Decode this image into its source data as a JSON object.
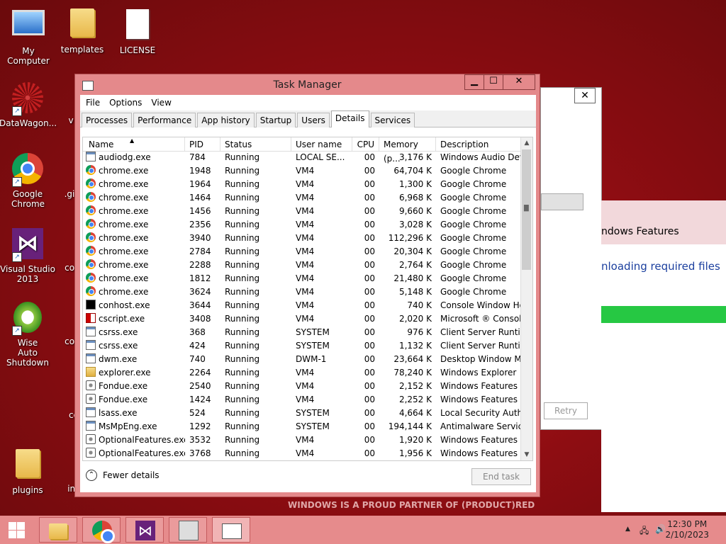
{
  "desktop": {
    "icons": [
      {
        "label": "My Computer"
      },
      {
        "label": "templates"
      },
      {
        "label": "LICENSE"
      },
      {
        "label": "DataWagon..."
      },
      {
        "label": "Google Chrome"
      },
      {
        "label": "Visual Studio 2013"
      },
      {
        "label": "Wise Auto Shutdown"
      },
      {
        "label": "plugins"
      }
    ],
    "partial_labels": [
      "v",
      ".gi",
      "com",
      "com",
      "co",
      "inc"
    ]
  },
  "background_window": {
    "close_glyph": "✕",
    "features_title": "ndows Features",
    "status_text": "nloading required files",
    "retry_label": "Retry"
  },
  "task_manager": {
    "title": "Task Manager",
    "menu": [
      "File",
      "Options",
      "View"
    ],
    "tabs": [
      "Processes",
      "Performance",
      "App history",
      "Startup",
      "Users",
      "Details",
      "Services"
    ],
    "active_tab": "Details",
    "columns": [
      "Name",
      "PID",
      "Status",
      "User name",
      "CPU",
      "Memory (p...",
      "Description"
    ],
    "rows": [
      {
        "icon": "window-icon",
        "name": "audiodg.exe",
        "pid": "784",
        "status": "Running",
        "user": "LOCAL SE...",
        "cpu": "00",
        "mem": "3,176 K",
        "desc": "Windows Audio Dev..."
      },
      {
        "icon": "chrome-icon",
        "name": "chrome.exe",
        "pid": "1948",
        "status": "Running",
        "user": "VM4",
        "cpu": "00",
        "mem": "64,704 K",
        "desc": "Google Chrome"
      },
      {
        "icon": "chrome-icon",
        "name": "chrome.exe",
        "pid": "1964",
        "status": "Running",
        "user": "VM4",
        "cpu": "00",
        "mem": "1,300 K",
        "desc": "Google Chrome"
      },
      {
        "icon": "chrome-icon",
        "name": "chrome.exe",
        "pid": "1464",
        "status": "Running",
        "user": "VM4",
        "cpu": "00",
        "mem": "6,968 K",
        "desc": "Google Chrome"
      },
      {
        "icon": "chrome-icon",
        "name": "chrome.exe",
        "pid": "1456",
        "status": "Running",
        "user": "VM4",
        "cpu": "00",
        "mem": "9,660 K",
        "desc": "Google Chrome"
      },
      {
        "icon": "chrome-icon",
        "name": "chrome.exe",
        "pid": "2356",
        "status": "Running",
        "user": "VM4",
        "cpu": "00",
        "mem": "3,028 K",
        "desc": "Google Chrome"
      },
      {
        "icon": "chrome-icon",
        "name": "chrome.exe",
        "pid": "3940",
        "status": "Running",
        "user": "VM4",
        "cpu": "00",
        "mem": "112,296 K",
        "desc": "Google Chrome"
      },
      {
        "icon": "chrome-icon",
        "name": "chrome.exe",
        "pid": "2784",
        "status": "Running",
        "user": "VM4",
        "cpu": "00",
        "mem": "20,304 K",
        "desc": "Google Chrome"
      },
      {
        "icon": "chrome-icon",
        "name": "chrome.exe",
        "pid": "2288",
        "status": "Running",
        "user": "VM4",
        "cpu": "00",
        "mem": "2,764 K",
        "desc": "Google Chrome"
      },
      {
        "icon": "chrome-icon",
        "name": "chrome.exe",
        "pid": "1812",
        "status": "Running",
        "user": "VM4",
        "cpu": "00",
        "mem": "21,480 K",
        "desc": "Google Chrome"
      },
      {
        "icon": "chrome-icon",
        "name": "chrome.exe",
        "pid": "3624",
        "status": "Running",
        "user": "VM4",
        "cpu": "00",
        "mem": "5,148 K",
        "desc": "Google Chrome"
      },
      {
        "icon": "console-icon",
        "name": "conhost.exe",
        "pid": "3644",
        "status": "Running",
        "user": "VM4",
        "cpu": "00",
        "mem": "740 K",
        "desc": "Console Window Host"
      },
      {
        "icon": "script-icon",
        "name": "cscript.exe",
        "pid": "3408",
        "status": "Running",
        "user": "VM4",
        "cpu": "00",
        "mem": "2,020 K",
        "desc": "Microsoft ® Consol..."
      },
      {
        "icon": "window-icon",
        "name": "csrss.exe",
        "pid": "368",
        "status": "Running",
        "user": "SYSTEM",
        "cpu": "00",
        "mem": "976 K",
        "desc": "Client Server Runtim..."
      },
      {
        "icon": "window-icon",
        "name": "csrss.exe",
        "pid": "424",
        "status": "Running",
        "user": "SYSTEM",
        "cpu": "00",
        "mem": "1,132 K",
        "desc": "Client Server Runtim..."
      },
      {
        "icon": "window-icon",
        "name": "dwm.exe",
        "pid": "740",
        "status": "Running",
        "user": "DWM-1",
        "cpu": "00",
        "mem": "23,664 K",
        "desc": "Desktop Window M..."
      },
      {
        "icon": "folder-icon",
        "name": "explorer.exe",
        "pid": "2264",
        "status": "Running",
        "user": "VM4",
        "cpu": "00",
        "mem": "78,240 K",
        "desc": "Windows Explorer"
      },
      {
        "icon": "gear-icon",
        "name": "Fondue.exe",
        "pid": "2540",
        "status": "Running",
        "user": "VM4",
        "cpu": "00",
        "mem": "2,152 K",
        "desc": "Windows Features o..."
      },
      {
        "icon": "gear-icon",
        "name": "Fondue.exe",
        "pid": "1424",
        "status": "Running",
        "user": "VM4",
        "cpu": "00",
        "mem": "2,252 K",
        "desc": "Windows Features o..."
      },
      {
        "icon": "window-icon",
        "name": "lsass.exe",
        "pid": "524",
        "status": "Running",
        "user": "SYSTEM",
        "cpu": "00",
        "mem": "4,664 K",
        "desc": "Local Security Autho..."
      },
      {
        "icon": "window-icon",
        "name": "MsMpEng.exe",
        "pid": "1292",
        "status": "Running",
        "user": "SYSTEM",
        "cpu": "00",
        "mem": "194,144 K",
        "desc": "Antimalware Service..."
      },
      {
        "icon": "gear-icon",
        "name": "OptionalFeatures.exe",
        "pid": "3532",
        "status": "Running",
        "user": "VM4",
        "cpu": "00",
        "mem": "1,920 K",
        "desc": "Windows Features"
      },
      {
        "icon": "gear-icon",
        "name": "OptionalFeatures.exe",
        "pid": "3768",
        "status": "Running",
        "user": "VM4",
        "cpu": "00",
        "mem": "1,956 K",
        "desc": "Windows Features"
      }
    ],
    "fewer_details": "Fewer details",
    "end_task": "End task"
  },
  "watermark": "WINDOWS IS A PROUD PARTNER OF (PRODUCT)RED",
  "taskbar": {
    "time": "12:30 PM",
    "date": "2/10/2023"
  }
}
